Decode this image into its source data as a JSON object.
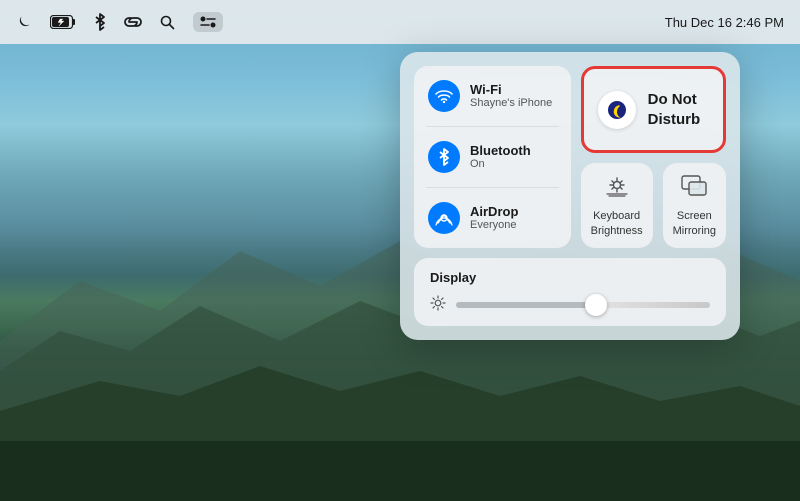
{
  "desktop": {
    "bg_description": "macOS mountain landscape"
  },
  "menubar": {
    "datetime": "Thu Dec 16  2:46 PM",
    "icons": [
      {
        "name": "do-not-disturb-moon-icon",
        "symbol": "🌙"
      },
      {
        "name": "battery-charging-icon",
        "symbol": "🔋"
      },
      {
        "name": "bluetooth-menu-icon",
        "symbol": "✳"
      },
      {
        "name": "link-icon",
        "symbol": "🔗"
      },
      {
        "name": "search-icon",
        "symbol": "🔍"
      }
    ]
  },
  "control_center": {
    "network_tile": {
      "wifi": {
        "title": "Wi-Fi",
        "subtitle": "Shayne's iPhone",
        "icon": "📡"
      },
      "bluetooth": {
        "title": "Bluetooth",
        "subtitle": "On",
        "icon": "✳"
      },
      "airdrop": {
        "title": "AirDrop",
        "subtitle": "Everyone",
        "icon": "📶"
      }
    },
    "dnd_tile": {
      "title": "Do Not\nDisturb",
      "icon": "🌙"
    },
    "keyboard_brightness": {
      "label": "Keyboard\nBrightness",
      "icon": "☀"
    },
    "screen_mirroring": {
      "label": "Screen\nMirroring",
      "icon": "⬜"
    },
    "display_section": {
      "title": "Display",
      "slider_value": 55
    }
  }
}
